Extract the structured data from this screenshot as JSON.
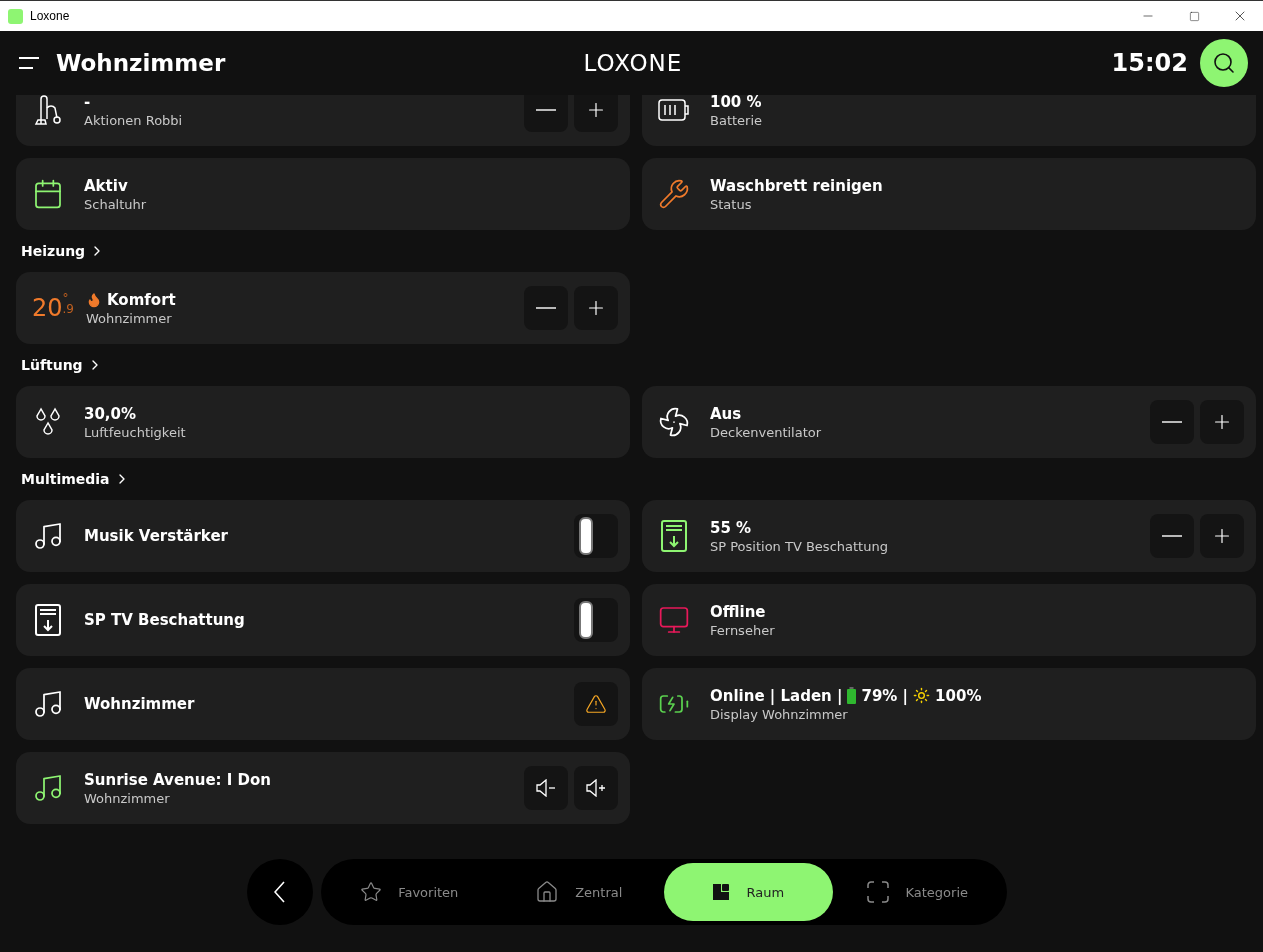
{
  "window": {
    "title": "Loxone"
  },
  "header": {
    "room": "Wohnzimmer",
    "logo": "LOXONE",
    "time": "15:02"
  },
  "sections": [
    {
      "rows": [
        {
          "left": {
            "kind": "vacuum",
            "title": "-",
            "subtitle": "Aktionen Robbi",
            "controls": [
              {
                "kind": "minus"
              },
              {
                "kind": "plus"
              }
            ]
          },
          "right": {
            "kind": "battery",
            "title": "100 %",
            "subtitle": "Batterie"
          }
        },
        {
          "left": {
            "kind": "calendar",
            "color": "#8ef572",
            "title": "Aktiv",
            "subtitle": "Schaltuhr"
          },
          "right": {
            "kind": "wrench",
            "color": "#f07a2b",
            "title": "Waschbrett reinigen",
            "subtitle": "Status"
          }
        }
      ]
    },
    {
      "heading": "Heizung",
      "rows": [
        {
          "left": {
            "kind": "thermostat",
            "color": "#f07a2b",
            "temp": "20",
            "degree": "°",
            "decimal": ".9",
            "title": "Komfort",
            "subtitle": "Wohnzimmer",
            "controls": [
              {
                "kind": "minus"
              },
              {
                "kind": "plus"
              }
            ]
          }
        }
      ]
    },
    {
      "heading": "Lüftung",
      "rows": [
        {
          "left": {
            "kind": "droplets",
            "title": "30,0%",
            "subtitle": "Luftfeuchtigkeit"
          },
          "right": {
            "kind": "fan",
            "title": "Aus",
            "subtitle": "Deckenventilator",
            "controls": [
              {
                "kind": "minus"
              },
              {
                "kind": "plus"
              }
            ]
          }
        }
      ]
    },
    {
      "heading": "Multimedia",
      "rows": [
        {
          "left": {
            "kind": "music",
            "title": "Musik Verstärker",
            "controls": [
              {
                "kind": "switch",
                "on": false
              }
            ]
          },
          "right": {
            "kind": "blinds",
            "color": "#8ef572",
            "title": "55 %",
            "subtitle": "SP Position TV Beschattung",
            "controls": [
              {
                "kind": "minus"
              },
              {
                "kind": "plus"
              }
            ]
          }
        },
        {
          "left": {
            "kind": "blinds",
            "title": "SP TV Beschattung",
            "controls": [
              {
                "kind": "switch",
                "on": false
              }
            ]
          },
          "right": {
            "kind": "monitor",
            "color": "#e8195a",
            "title": "Offline",
            "subtitle": "Fernseher"
          }
        },
        {
          "left": {
            "kind": "music",
            "title": "Wohnzimmer",
            "controls": [
              {
                "kind": "warning"
              }
            ]
          },
          "right": {
            "kind": "charging",
            "color": "#5bd14f",
            "title_segments": [
              "Online | Laden |",
              "79% |",
              "100%"
            ],
            "subtitle": "Display Wohnzimmer"
          }
        },
        {
          "left": {
            "kind": "music",
            "color": "#8ef572",
            "title": "Sunrise Avenue: I Don",
            "subtitle": "Wohnzimmer",
            "controls": [
              {
                "kind": "volume-down"
              },
              {
                "kind": "volume-up"
              }
            ]
          }
        }
      ]
    }
  ],
  "nav": {
    "tabs": [
      {
        "kind": "star",
        "label": "Favoriten",
        "selected": false
      },
      {
        "kind": "house",
        "label": "Zentral",
        "selected": false
      },
      {
        "kind": "room",
        "label": "Raum",
        "selected": true
      },
      {
        "kind": "category",
        "label": "Kategorie",
        "selected": false
      }
    ]
  }
}
